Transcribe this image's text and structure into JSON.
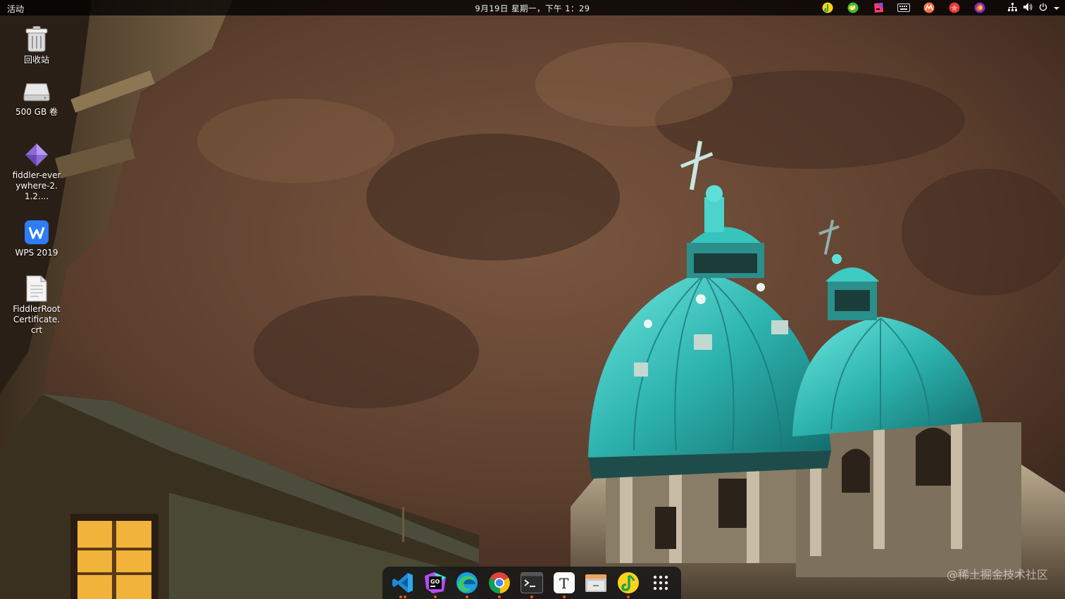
{
  "topbar": {
    "activities": "活动",
    "clock": "9月19日 星期一，下午 1：29",
    "tray_apps": [
      "qqmusic-icon",
      "wechat-icon",
      "jetbrains-toolbox-icon",
      "keyboard-icon",
      "maps-icon",
      "screenshot-icon",
      "firefox-icon"
    ],
    "system": [
      "network-icon",
      "volume-icon",
      "power-icon",
      "chevron-down-icon"
    ]
  },
  "desktop": {
    "icons": [
      {
        "label": "回收站",
        "icon": "trash-icon"
      },
      {
        "label": "500 GB 卷",
        "icon": "drive-icon"
      },
      {
        "label": "fiddler-everywhere-2.1.2....",
        "icon": "fiddler-icon"
      },
      {
        "label": "WPS 2019",
        "icon": "wps-icon"
      },
      {
        "label": "FiddlerRootCertificate.crt",
        "icon": "certificate-file-icon"
      }
    ]
  },
  "dock": {
    "items": [
      {
        "icon": "vscode-icon",
        "running": 2
      },
      {
        "icon": "goland-icon",
        "running": 1
      },
      {
        "icon": "edge-icon",
        "running": 1
      },
      {
        "icon": "chrome-icon",
        "running": 1
      },
      {
        "icon": "terminal-icon",
        "running": 1
      },
      {
        "icon": "typora-icon",
        "running": 1
      },
      {
        "icon": "file-manager-icon",
        "running": 0
      },
      {
        "icon": "qqmusic-icon",
        "running": 1
      },
      {
        "icon": "show-apps-icon",
        "running": 0
      }
    ]
  },
  "watermark": "@稀土掘金技术社区",
  "colors": {
    "sky": "#6b4a36",
    "dome": "#3ec8c4",
    "window": "#f4b43a",
    "topbar": "#000000",
    "dock": "#181818"
  }
}
